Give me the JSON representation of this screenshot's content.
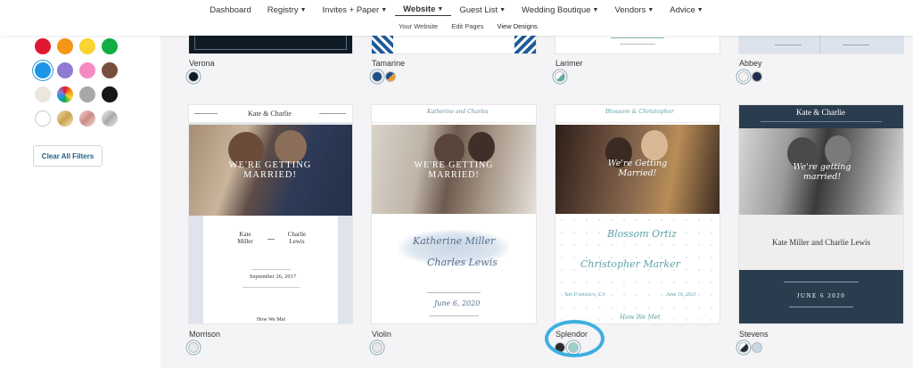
{
  "nav": {
    "items": [
      {
        "label": "Dashboard",
        "chevron": false,
        "active": false
      },
      {
        "label": "Registry",
        "chevron": true,
        "active": false
      },
      {
        "label": "Invites + Paper",
        "chevron": true,
        "active": false
      },
      {
        "label": "Website",
        "chevron": true,
        "active": true
      },
      {
        "label": "Guest List",
        "chevron": true,
        "active": false
      },
      {
        "label": "Wedding Boutique",
        "chevron": true,
        "active": false
      },
      {
        "label": "Vendors",
        "chevron": true,
        "active": false
      },
      {
        "label": "Advice",
        "chevron": true,
        "active": false
      }
    ],
    "sub": [
      "Your Website",
      "Edit Pages",
      "View Designs"
    ]
  },
  "colors": [
    {
      "name": "red",
      "hex": "#e01731"
    },
    {
      "name": "orange",
      "hex": "#f49616"
    },
    {
      "name": "yellow",
      "hex": "#fad430"
    },
    {
      "name": "green",
      "hex": "#12ad45"
    },
    {
      "name": "blue",
      "hex": "#1d95e7",
      "selected": true
    },
    {
      "name": "purple",
      "hex": "#8f7bd1"
    },
    {
      "name": "pink",
      "hex": "#f58ac2"
    },
    {
      "name": "brown",
      "hex": "#7a4e3d"
    },
    {
      "name": "ivory",
      "hex": "#ece6de"
    },
    {
      "name": "multicolor",
      "hex": "rainbow"
    },
    {
      "name": "gray",
      "hex": "#a8a8a8"
    },
    {
      "name": "black",
      "hex": "#161616"
    },
    {
      "name": "white",
      "hex": "#ffffff"
    },
    {
      "name": "gold",
      "hex": "gold"
    },
    {
      "name": "rose-gold",
      "hex": "rosegold"
    },
    {
      "name": "silver",
      "hex": "silver"
    }
  ],
  "clear_filters": "Clear All Filters",
  "designs": {
    "verona": {
      "label": "Verona"
    },
    "tamarine": {
      "label": "Tamarine"
    },
    "larimer": {
      "label": "Larimer"
    },
    "abbey": {
      "label": "Abbey"
    },
    "morrison": {
      "label": "Morrison",
      "header": "Kate & Charlie",
      "overlay": "WE'RE GETTING MARRIED!",
      "name1": "Kate Miller",
      "name2": "Charlie Lewis",
      "date": "September 26, 2017",
      "section": "How We Met"
    },
    "violin": {
      "label": "Violin",
      "header": "Katherine and Charles",
      "overlay": "WE'RE GETTING MARRIED!",
      "name1": "Katherine Miller",
      "name2": "Charles Lewis",
      "date": "June 6, 2020"
    },
    "splendor": {
      "label": "Splendor",
      "header": "Blossom & Christopher",
      "overlay": "We're Getting Married!",
      "name1": "Blossom Ortiz",
      "name2": "Christopher Marker",
      "location": "San Francisco, CA",
      "date": "June 16, 2021",
      "section": "How We Met"
    },
    "stevens": {
      "label": "Stevens",
      "header": "Kate & Charlie",
      "overlay": "We're getting married!",
      "names": "Kate Miller and Charlie Lewis",
      "date": "JUNE 6 2020"
    }
  }
}
